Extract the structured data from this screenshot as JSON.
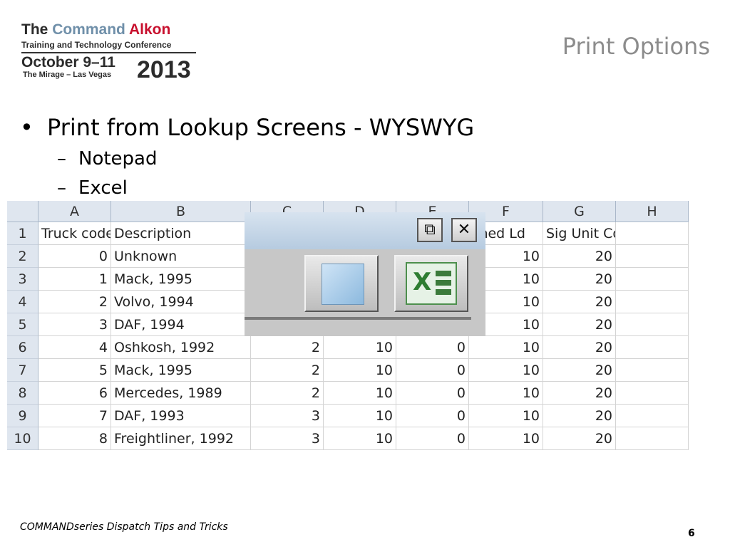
{
  "logo": {
    "the": "The",
    "command": "Command",
    "alkon": "Alkon",
    "line2": "Training and Technology Conference",
    "dates": "October 9–11",
    "venue": "The Mirage – Las Vegas",
    "year": "2013"
  },
  "slide_title": "Print Options",
  "bullets": {
    "main": "Print from Lookup Screens - WYSWYG",
    "sub1": "Notepad",
    "sub2": "Excel",
    "bullet_glyph": "•",
    "dash_glyph": "–"
  },
  "spreadsheet": {
    "columns": [
      "A",
      "B",
      "C",
      "D",
      "E",
      "F",
      "G",
      "H"
    ],
    "header_row": {
      "row": "1",
      "A": "Truck code",
      "B": "Description",
      "F": "ched Ld",
      "G": "Sig Unit Code"
    },
    "rows": [
      {
        "row": "2",
        "A": "0",
        "B": "Unknown",
        "C": "",
        "D": "",
        "E": "",
        "F": "10",
        "G": "20"
      },
      {
        "row": "3",
        "A": "1",
        "B": "Mack, 1995",
        "C": "",
        "D": "",
        "E": "",
        "F": "10",
        "G": "20"
      },
      {
        "row": "4",
        "A": "2",
        "B": "Volvo, 1994",
        "C": "",
        "D": "",
        "E": "",
        "F": "10",
        "G": "20"
      },
      {
        "row": "5",
        "A": "3",
        "B": "DAF, 1994",
        "C": "",
        "D": "",
        "E": "",
        "F": "10",
        "G": "20"
      },
      {
        "row": "6",
        "A": "4",
        "B": "Oshkosh, 1992",
        "C": "2",
        "D": "10",
        "E": "0",
        "F": "10",
        "G": "20"
      },
      {
        "row": "7",
        "A": "5",
        "B": "Mack, 1995",
        "C": "2",
        "D": "10",
        "E": "0",
        "F": "10",
        "G": "20"
      },
      {
        "row": "8",
        "A": "6",
        "B": "Mercedes, 1989",
        "C": "2",
        "D": "10",
        "E": "0",
        "F": "10",
        "G": "20"
      },
      {
        "row": "9",
        "A": "7",
        "B": "DAF, 1993",
        "C": "3",
        "D": "10",
        "E": "0",
        "F": "10",
        "G": "20"
      },
      {
        "row": "10",
        "A": "8",
        "B": "Freightliner, 1992",
        "C": "3",
        "D": "10",
        "E": "0",
        "F": "10",
        "G": "20"
      }
    ]
  },
  "toolbar": {
    "restore_glyph": "⧉",
    "close_glyph": "✕",
    "tools": [
      "notepad-icon",
      "excel-icon"
    ],
    "excel_glyph": "X"
  },
  "footer": {
    "text": "COMMANDseries Dispatch Tips and Tricks",
    "page": "6"
  }
}
